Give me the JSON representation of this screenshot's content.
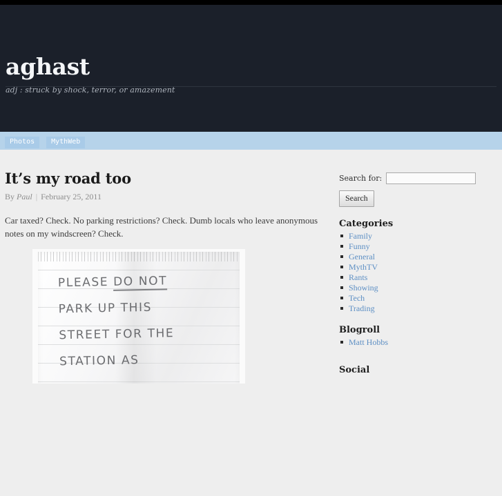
{
  "site": {
    "title": "aghast",
    "tagline": "adj : struck by shock, terror, or amazement"
  },
  "nav": {
    "items": [
      {
        "label": "Photos"
      },
      {
        "label": "MythWeb"
      }
    ]
  },
  "post": {
    "title": "It’s my road too",
    "meta": {
      "by_prefix": "By",
      "author": "Paul",
      "separator": "|",
      "date": "February 25, 2011"
    },
    "body": "Car taxed?  Check.  No parking restrictions?  Check.  Dumb locals who leave anonymous notes on my windscreen?  Check.",
    "image": {
      "alt": "handwritten-note-photo",
      "note_lines": [
        "PLEASE DO NOT",
        "PARK UP THIS",
        "STREET FOR THE",
        "STATION AS"
      ]
    }
  },
  "sidebar": {
    "search": {
      "label": "Search for:",
      "value": "",
      "placeholder": "",
      "button_label": "Search"
    },
    "categories": {
      "title": "Categories",
      "items": [
        {
          "label": "Family"
        },
        {
          "label": "Funny"
        },
        {
          "label": "General"
        },
        {
          "label": "MythTV"
        },
        {
          "label": "Rants"
        },
        {
          "label": "Showing"
        },
        {
          "label": "Tech"
        },
        {
          "label": "Trading"
        }
      ]
    },
    "blogroll": {
      "title": "Blogroll",
      "items": [
        {
          "label": "Matt Hobbs"
        }
      ]
    },
    "social": {
      "title": "Social"
    }
  },
  "colors": {
    "header_bg": "#1b202a",
    "nav_bg": "#b6d3ea",
    "nav_item_bg": "#a9cbe8",
    "body_bg": "#eeeeee",
    "link": "#5d8fc4"
  }
}
